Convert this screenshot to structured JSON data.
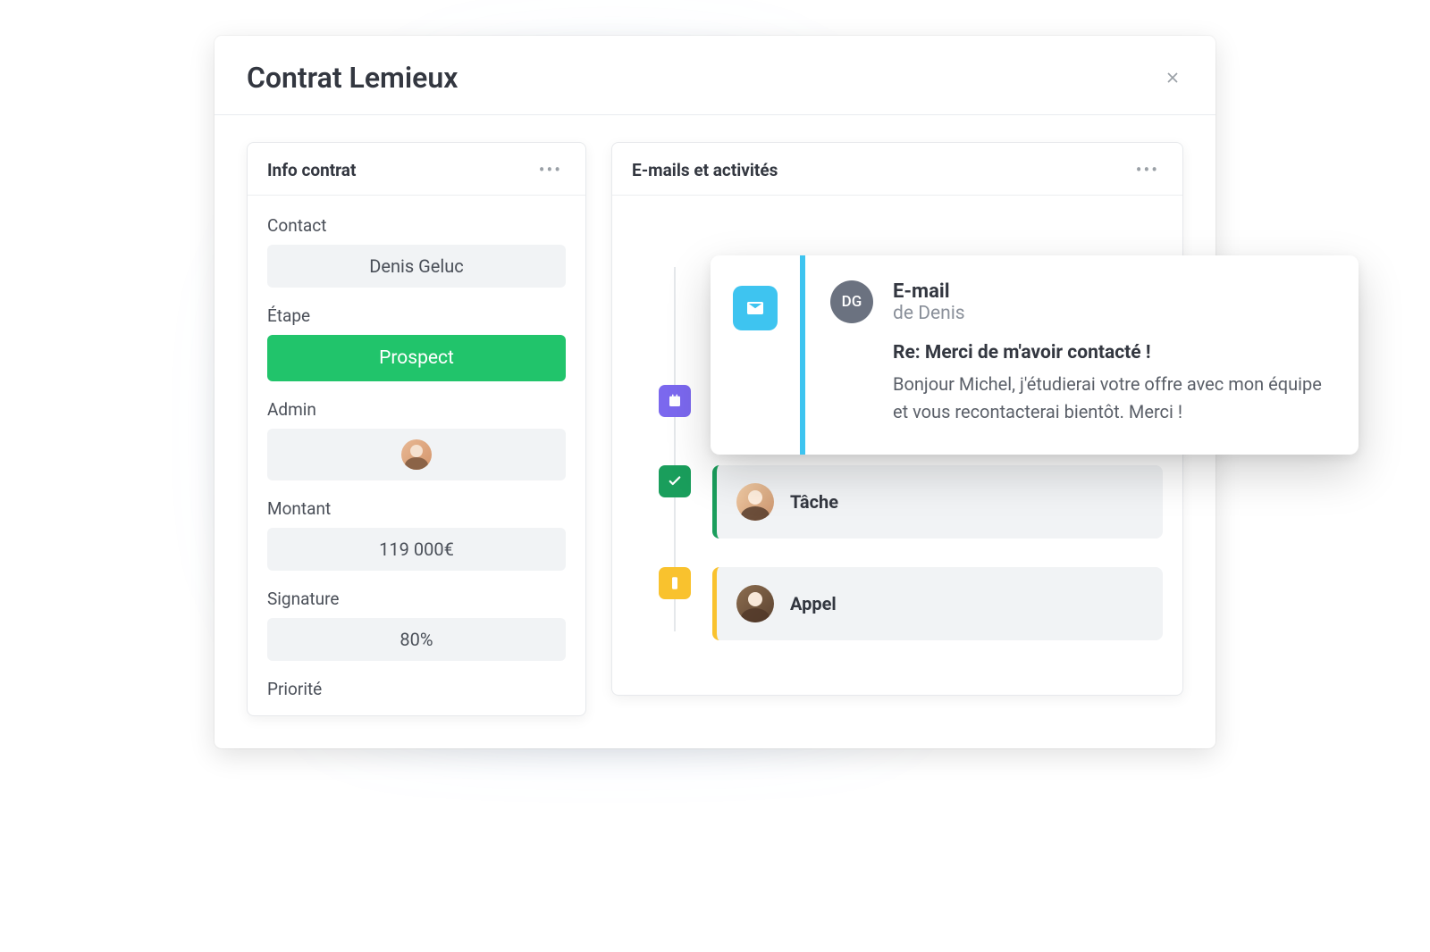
{
  "header": {
    "title": "Contrat Lemieux"
  },
  "info_panel": {
    "title": "Info contrat",
    "fields": {
      "contact": {
        "label": "Contact",
        "value": "Denis Geluc"
      },
      "stage": {
        "label": "Étape",
        "value": "Prospect"
      },
      "admin": {
        "label": "Admin"
      },
      "amount": {
        "label": "Montant",
        "value": "119 000€"
      },
      "signature": {
        "label": "Signature",
        "value": "80%"
      },
      "priority": {
        "label": "Priorité"
      }
    }
  },
  "activity_panel": {
    "title": "E-mails et activités",
    "items": {
      "task": {
        "label": "Tâche"
      },
      "call": {
        "label": "Appel"
      }
    }
  },
  "email_popup": {
    "type_label": "E-mail",
    "from": "de Denis",
    "initials": "DG",
    "subject": "Re: Merci de m'avoir contacté !",
    "body": "Bonjour Michel, j'étudierai votre offre avec mon équipe et vous recontacterai bientôt. Merci !"
  },
  "colors": {
    "stage_green": "#21c46b",
    "email_blue": "#3ec4f0",
    "calendar_purple": "#7b68ee",
    "task_green": "#1a9e5c",
    "call_yellow": "#f9c22e"
  }
}
